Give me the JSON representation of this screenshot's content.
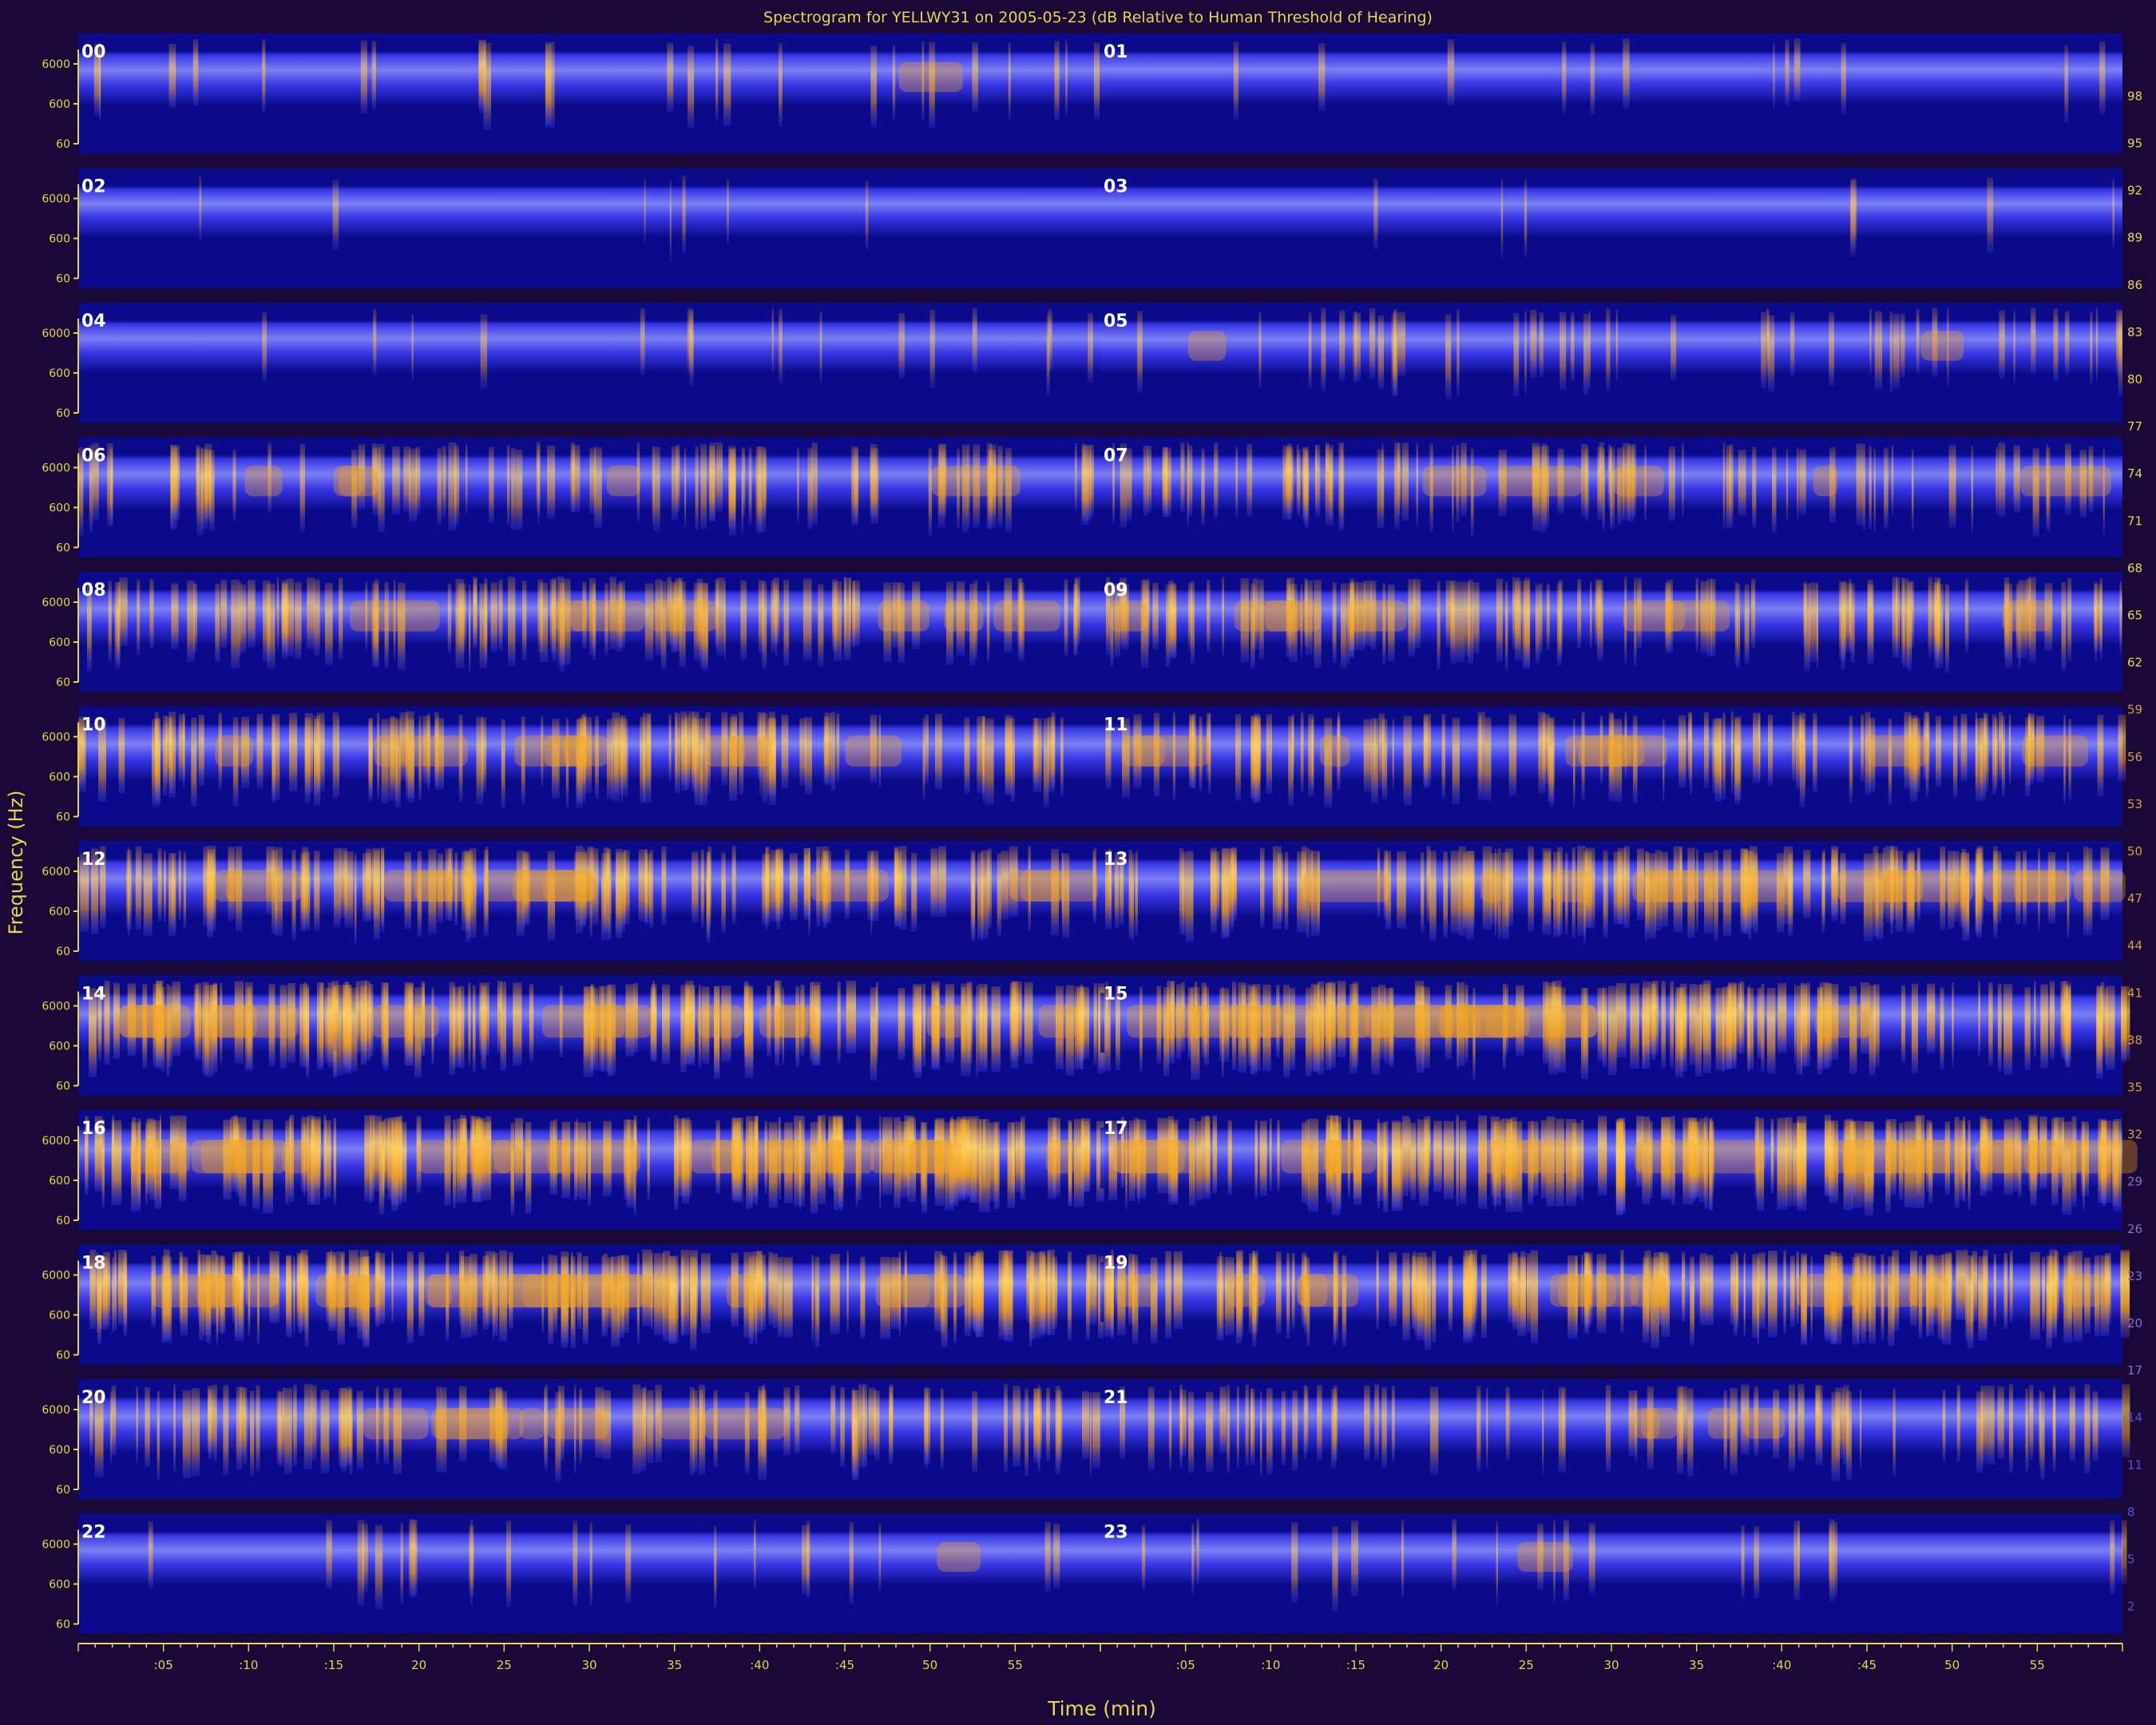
{
  "chart_data": {
    "type": "heatmap",
    "title": "Spectrogram for YELLWY31 on 2005-05-23 (dB Relative to Human Threshold of Hearing)",
    "xlabel": "Time (min)",
    "ylabel": "Frequency (Hz)",
    "x_tick_labels": [
      ":05",
      ":10",
      ":15",
      "20",
      "25",
      "30",
      "35",
      ":40",
      ":45",
      "50",
      "55"
    ],
    "y_tick_labels": [
      "6000",
      "600",
      "60"
    ],
    "colorbar_ticks": [
      98,
      95,
      92,
      89,
      86,
      83,
      80,
      77,
      74,
      71,
      68,
      65,
      62,
      59,
      56,
      53,
      50,
      47,
      44,
      41,
      38,
      35,
      32,
      29,
      26,
      23,
      20,
      17,
      14,
      11,
      8,
      5,
      2
    ],
    "colorbar_range": [
      0,
      100
    ],
    "hours": [
      {
        "label": "00",
        "density": 0.15,
        "intensity": 0.35
      },
      {
        "label": "01",
        "density": 0.05,
        "intensity": 0.25
      },
      {
        "label": "02",
        "density": 0.02,
        "intensity": 0.15
      },
      {
        "label": "03",
        "density": 0.02,
        "intensity": 0.15
      },
      {
        "label": "04",
        "density": 0.08,
        "intensity": 0.2
      },
      {
        "label": "05",
        "density": 0.3,
        "intensity": 0.3
      },
      {
        "label": "06",
        "density": 0.55,
        "intensity": 0.4
      },
      {
        "label": "07",
        "density": 0.6,
        "intensity": 0.4
      },
      {
        "label": "08",
        "density": 0.7,
        "intensity": 0.45
      },
      {
        "label": "09",
        "density": 0.75,
        "intensity": 0.45
      },
      {
        "label": "10",
        "density": 0.75,
        "intensity": 0.5
      },
      {
        "label": "11",
        "density": 0.7,
        "intensity": 0.5
      },
      {
        "label": "12",
        "density": 0.8,
        "intensity": 0.55
      },
      {
        "label": "13",
        "density": 0.8,
        "intensity": 0.6
      },
      {
        "label": "14",
        "density": 0.9,
        "intensity": 0.7
      },
      {
        "label": "15",
        "density": 0.9,
        "intensity": 0.7
      },
      {
        "label": "16",
        "density": 0.95,
        "intensity": 0.8
      },
      {
        "label": "17",
        "density": 0.95,
        "intensity": 0.8
      },
      {
        "label": "18",
        "density": 0.9,
        "intensity": 0.75
      },
      {
        "label": "19",
        "density": 0.85,
        "intensity": 0.7
      },
      {
        "label": "20",
        "density": 0.6,
        "intensity": 0.5
      },
      {
        "label": "21",
        "density": 0.45,
        "intensity": 0.45
      },
      {
        "label": "22",
        "density": 0.12,
        "intensity": 0.3
      },
      {
        "label": "23",
        "density": 0.12,
        "intensity": 0.3
      }
    ],
    "colors": {
      "background": "#1a0838",
      "axis": "#e6d64a",
      "panel_low": "#0a0a8a",
      "band_mid": "#3c3cf0",
      "band_high": "#8a8cff",
      "event": "#f2a020",
      "event_peak": "#ffd060",
      "hour_label": "#ffffff"
    }
  }
}
